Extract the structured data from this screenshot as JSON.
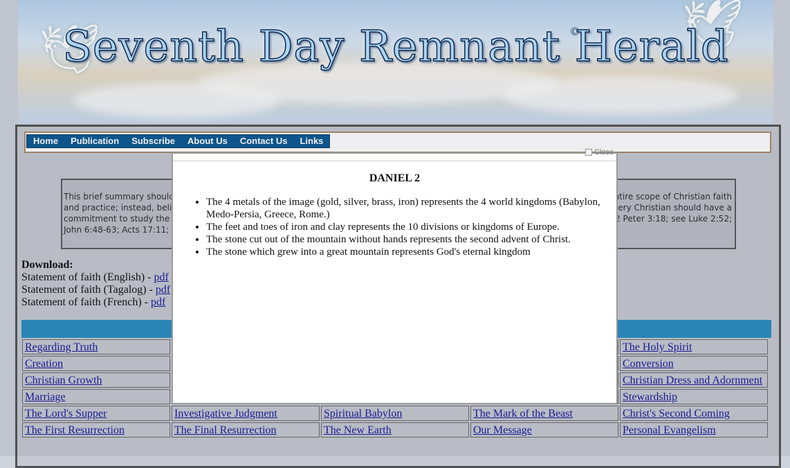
{
  "header": {
    "title": "Seventh Day Remnant Herald",
    "copyright": "©"
  },
  "nav": [
    "Home",
    "Publication",
    "Subscribe",
    "About Us",
    "Contact Us",
    "Links"
  ],
  "summary": {
    "left_lines": [
      "This brief summary should",
      "and practice; instead, belie",
      "commitment to study the W",
      "John 6:48-63; Acts 17:11; 2"
    ],
    "right_lines": [
      "ntire scope of Christian faith",
      "ery Christian should have a",
      "2 Peter 3:18; see Luke 2:52;"
    ]
  },
  "download": {
    "heading": "Download:",
    "items": [
      {
        "label": "Statement of faith (English) - ",
        "link": "pdf"
      },
      {
        "label": "Statement of faith (Tagalog) - ",
        "link": "pdf"
      },
      {
        "label": "Statement of faith (French) - ",
        "link": "pdf"
      }
    ]
  },
  "topics": [
    [
      "Regarding Truth",
      "",
      "",
      "",
      "The Holy Spirit"
    ],
    [
      "Creation",
      "",
      "",
      "",
      "Conversion"
    ],
    [
      "Christian Growth",
      "",
      "",
      "",
      "Christian Dress and Adornment"
    ],
    [
      "Marriage",
      "",
      "",
      "",
      "Stewardship"
    ],
    [
      "The Lord's Supper",
      "Investigative Judgment",
      "Spiritual Babylon",
      "The Mark of the Beast",
      "Christ's Second Coming"
    ],
    [
      "The First Resurrection",
      "The Final Resurrection",
      "The New Earth",
      "Our Message",
      "Personal Evangelism"
    ]
  ],
  "modal": {
    "close_label": "Close",
    "title": "DANIEL 2",
    "items": [
      "The 4 metals of the image (gold, silver, brass, iron) represents the 4 world kingdoms (Babylon, Medo-Persia, Greece, Rome.)",
      "The feet and toes of iron and clay represents the 10 divisions or kingdoms of Europe.",
      "The stone cut out of the mountain without hands represents the second advent of Christ.",
      "The stone which grew into a great mountain represents God's eternal kingdom"
    ]
  }
}
